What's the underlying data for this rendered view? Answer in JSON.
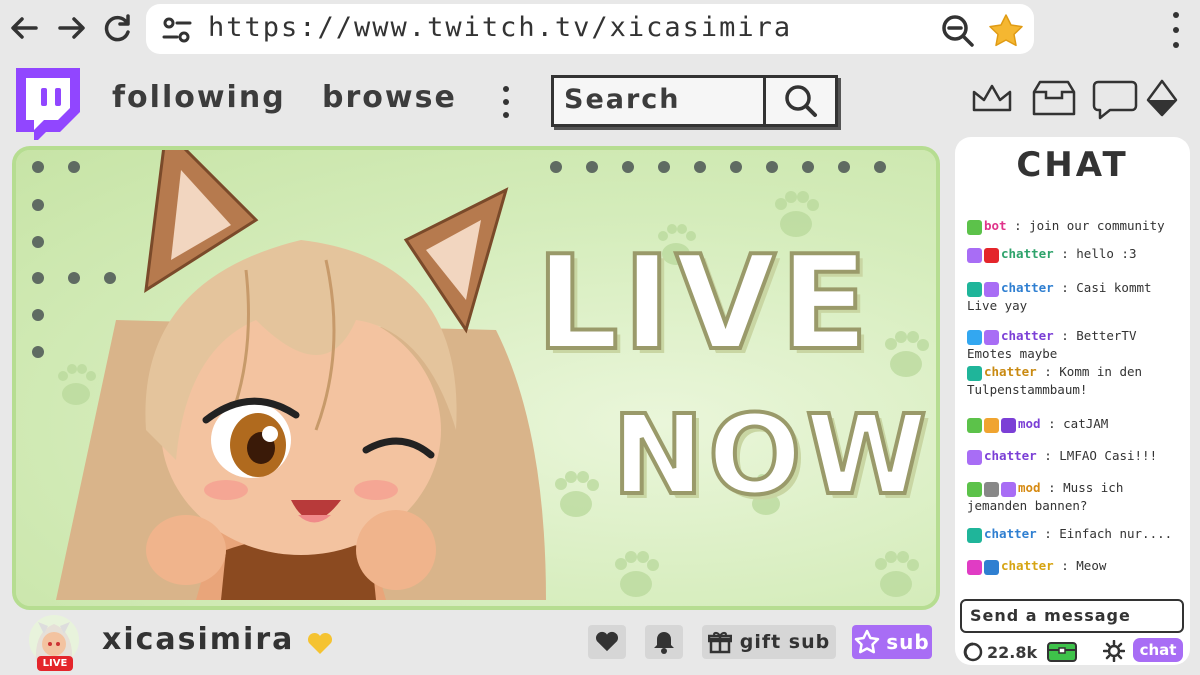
{
  "browser": {
    "url": "https://www.twitch.tv/xicasimira",
    "back_icon": "arrow-left-icon",
    "forward_icon": "arrow-right-icon",
    "reload_icon": "reload-icon",
    "site_settings_icon": "tune-icon",
    "zoom_icon": "zoom-out-icon",
    "bookmark_icon": "star-icon",
    "bookmark_color": "#f5b731"
  },
  "header": {
    "nav": [
      "following",
      "browse"
    ],
    "search_placeholder": "Search",
    "brand_color": "#9146ff",
    "icons": [
      "crown-icon",
      "inbox-icon",
      "chat-bubble-icon",
      "bits-gem-icon"
    ]
  },
  "stream": {
    "line1": "LIVE",
    "line2": "NOW",
    "bg_color": "#cfe9b1"
  },
  "chat": {
    "title": "CHAT",
    "messages": [
      {
        "badges": [
          "#5cc24a"
        ],
        "user": "bot",
        "color": "#e0338a",
        "text": "join our community"
      },
      {
        "badges": [
          "#a86df5",
          "#e4252b"
        ],
        "user": "chatter",
        "color": "#2ea36b",
        "text": "hello :3"
      },
      {
        "badges": [
          "#1fb59a",
          "#a86df5"
        ],
        "user": "chatter",
        "color": "#2f7fd1",
        "text": "Casi kommt Live yay"
      },
      {
        "badges": [
          "#33a7f0",
          "#a86df5"
        ],
        "user": "chatter",
        "color": "#7b3fd6",
        "text": "BetterTV Emotes maybe"
      },
      {
        "badges": [
          "#1fb59a"
        ],
        "user": "chatter",
        "color": "#c98a12",
        "text": "Komm in den Tulpenstammbaum!"
      },
      {
        "badges": [
          "#5cc24a",
          "#f0a430",
          "#7b3fd6"
        ],
        "user": "mod",
        "color": "#7b3fd6",
        "text": "catJAM"
      },
      {
        "badges": [
          "#a86df5"
        ],
        "user": "chatter",
        "color": "#7b3fd6",
        "text": "LMFAO Casi!!!"
      },
      {
        "badges": [
          "#5cc24a",
          "#888888",
          "#a86df5"
        ],
        "user": "mod",
        "color": "#d68a12",
        "text": "Muss ich jemanden bannen?"
      },
      {
        "badges": [
          "#1fb59a"
        ],
        "user": "chatter",
        "color": "#2f7fd1",
        "text": "Einfach nur...."
      },
      {
        "badges": [
          "#e03cc4",
          "#2f7fd1"
        ],
        "user": "chatter",
        "color": "#d6a412",
        "text": "Meow"
      }
    ],
    "input_placeholder": "Send a message",
    "points": "22.8k",
    "chat_button": "chat"
  },
  "channel": {
    "name": "xicasimira",
    "live_label": "LIVE",
    "verified_color": "#f5c331",
    "gift_label": "gift sub",
    "sub_label": "sub",
    "sub_color": "#a86df5"
  }
}
